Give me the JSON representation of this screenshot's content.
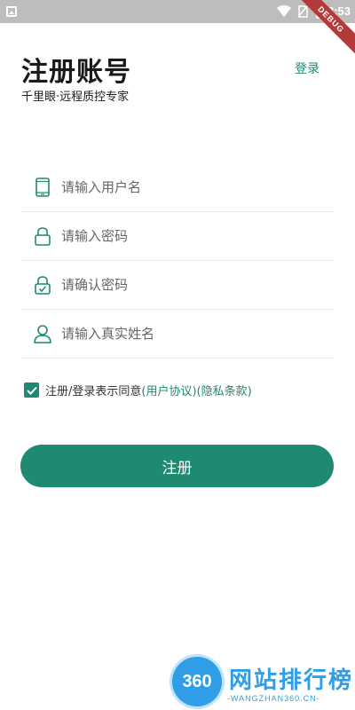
{
  "status_bar": {
    "time": "3:53",
    "debug_label": "DEBUG"
  },
  "header": {
    "title": "注册账号",
    "subtitle": "千里眼·远程质控专家",
    "login_link": "登录"
  },
  "form": {
    "fields": [
      {
        "icon": "phone-icon",
        "placeholder": "请输入用户名",
        "value": ""
      },
      {
        "icon": "lock-icon",
        "placeholder": "请输入密码",
        "value": ""
      },
      {
        "icon": "lock-check-icon",
        "placeholder": "请确认密码",
        "value": ""
      },
      {
        "icon": "person-icon",
        "placeholder": "请输入真实姓名",
        "value": ""
      }
    ]
  },
  "agreement": {
    "checked": true,
    "text": "注册/登录表示同意",
    "user_agreement": "(用户协议)",
    "privacy": "(隐私条款)"
  },
  "register_button": {
    "label": "注册"
  },
  "watermark": {
    "logo": "360",
    "text": "网站排行榜",
    "sub": "-WANGZHAN360.CN-"
  },
  "colors": {
    "accent": "#1e8a72",
    "status_bar": "#bdbdbd"
  }
}
